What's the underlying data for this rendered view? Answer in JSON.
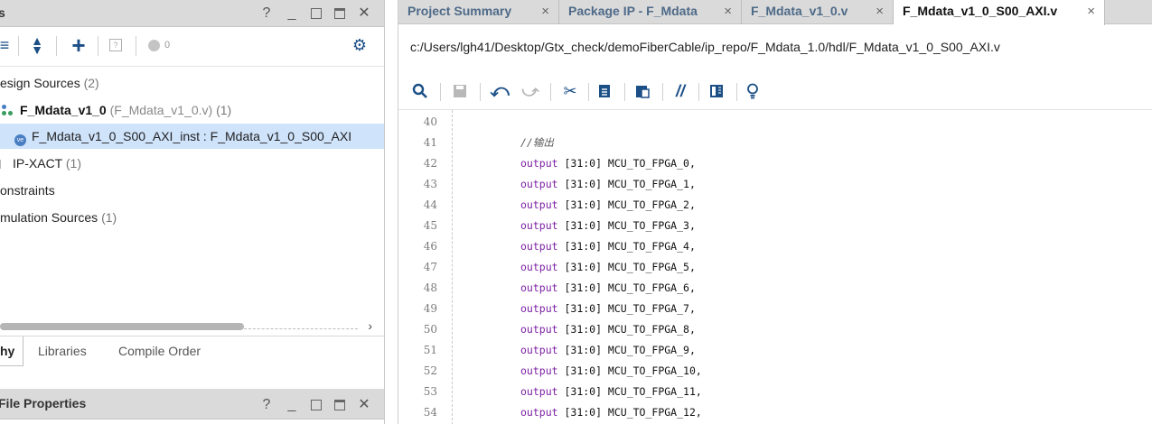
{
  "left_panel": {
    "sources_title": "s",
    "help_label": "?",
    "toolbar": {
      "add_label": "+",
      "count_label": "0"
    },
    "tree": [
      {
        "label": "esign Sources",
        "count": "(2)"
      },
      {
        "label": "F_Mdata_v1_0",
        "sub": "(F_Mdata_v1_0.v)",
        "count": "(1)"
      },
      {
        "label": "F_Mdata_v1_0_S00_AXI_inst : F_Mdata_v1_0_S00_AXI",
        "badge": "ve"
      },
      {
        "label": "IP-XACT",
        "count": "(1)"
      },
      {
        "label": "onstraints"
      },
      {
        "label": "mulation Sources",
        "count": "(1)"
      }
    ],
    "bottom_tabs": [
      {
        "label": "hy"
      },
      {
        "label": "Libraries"
      },
      {
        "label": "Compile Order"
      }
    ],
    "file_properties_title": "File Properties"
  },
  "editor": {
    "tabs": [
      {
        "label": "Project Summary",
        "active": false
      },
      {
        "label": "Package IP - F_Mdata",
        "active": false
      },
      {
        "label": "F_Mdata_v1_0.v",
        "active": false
      },
      {
        "label": "F_Mdata_v1_0_S00_AXI.v",
        "active": true
      }
    ],
    "close_glyph": "×",
    "file_path": "c:/Users/lgh41/Desktop/Gtx_check/demoFiberCable/ip_repo/F_Mdata_1.0/hdl/F_Mdata_v1_0_S00_AXI.v",
    "lines": [
      {
        "num": "40",
        "kw": "",
        "text": ""
      },
      {
        "num": "41",
        "kw": "",
        "text": "",
        "comment": "//输出"
      },
      {
        "num": "42",
        "kw": "output",
        "text": " [31:0] MCU_TO_FPGA_0,"
      },
      {
        "num": "43",
        "kw": "output",
        "text": " [31:0] MCU_TO_FPGA_1,"
      },
      {
        "num": "44",
        "kw": "output",
        "text": " [31:0] MCU_TO_FPGA_2,"
      },
      {
        "num": "45",
        "kw": "output",
        "text": " [31:0] MCU_TO_FPGA_3,"
      },
      {
        "num": "46",
        "kw": "output",
        "text": " [31:0] MCU_TO_FPGA_4,"
      },
      {
        "num": "47",
        "kw": "output",
        "text": " [31:0] MCU_TO_FPGA_5,"
      },
      {
        "num": "48",
        "kw": "output",
        "text": " [31:0] MCU_TO_FPGA_6,"
      },
      {
        "num": "49",
        "kw": "output",
        "text": " [31:0] MCU_TO_FPGA_7,"
      },
      {
        "num": "50",
        "kw": "output",
        "text": " [31:0] MCU_TO_FPGA_8,"
      },
      {
        "num": "51",
        "kw": "output",
        "text": " [31:0] MCU_TO_FPGA_9,"
      },
      {
        "num": "52",
        "kw": "output",
        "text": " [31:0] MCU_TO_FPGA_10,"
      },
      {
        "num": "53",
        "kw": "output",
        "text": " [31:0] MCU_TO_FPGA_11,"
      },
      {
        "num": "54",
        "kw": "output",
        "text": " [31:0] MCU_TO_FPGA_12,"
      }
    ]
  },
  "colors": {
    "keyword": "#7b1fa2",
    "selection": "#cfe3fb",
    "header_bg": "#dadada",
    "icon_blue": "#1b4f86"
  }
}
